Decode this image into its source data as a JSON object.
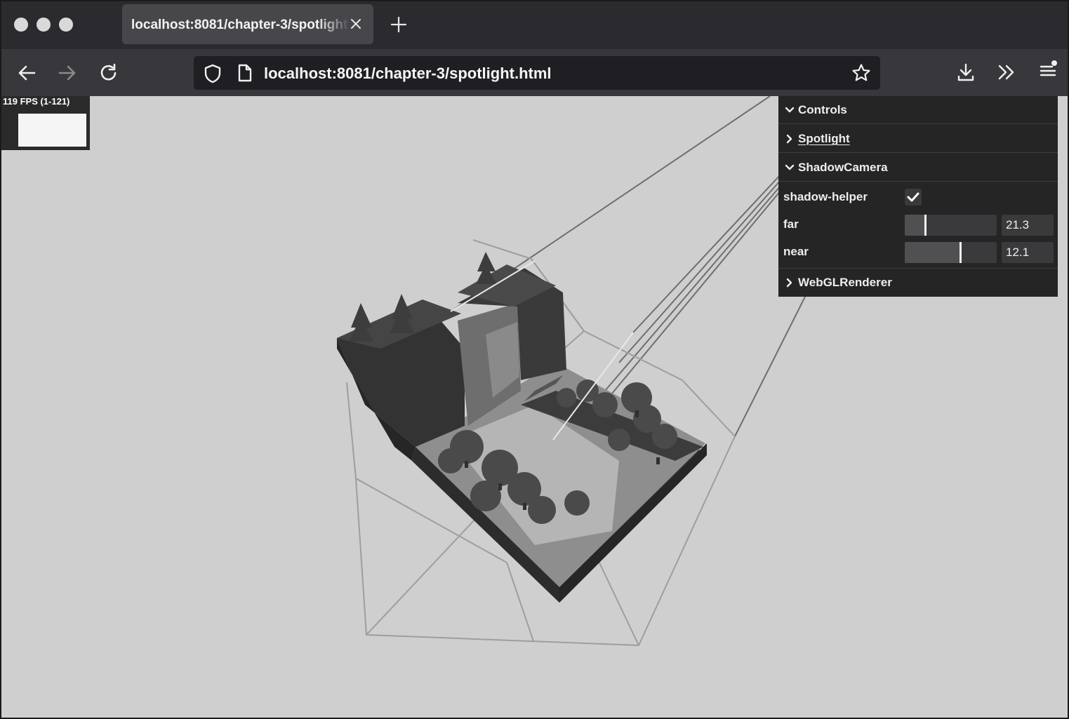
{
  "browser": {
    "tab_title": "localhost:8081/chapter-3/spotlight.html",
    "url": "localhost:8081/chapter-3/spotlight.html"
  },
  "stats": {
    "fps_label": "119 FPS (1-121)"
  },
  "gui": {
    "controls_title": "Controls",
    "spotlight_title": "Spotlight",
    "shadowcamera_title": "ShadowCamera",
    "shadow_helper_label": "shadow-helper",
    "shadow_helper_checked": true,
    "far_label": "far",
    "far_value": "21.3",
    "far_slider_fraction": 0.22,
    "near_label": "near",
    "near_value": "12.1",
    "near_slider_fraction": 0.6,
    "webglrenderer_title": "WebGLRenderer"
  },
  "icons": {
    "back": "back-arrow-icon",
    "forward": "forward-arrow-icon",
    "reload": "reload-icon",
    "shield": "shield-icon",
    "page": "page-icon",
    "star": "bookmark-star-icon",
    "download": "download-icon",
    "overflow": "overflow-chevrons-icon",
    "menu": "hamburger-menu-icon"
  }
}
